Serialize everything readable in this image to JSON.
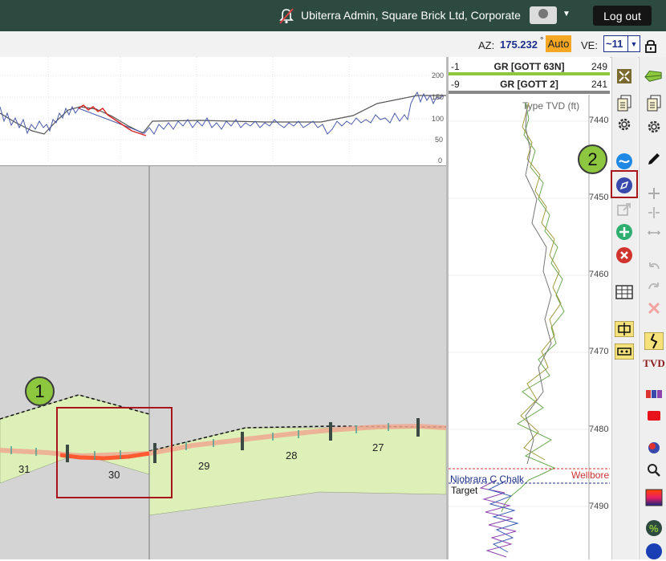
{
  "header": {
    "user_label": "Ubiterra Admin, Square Brick Ltd, Corporate",
    "logout_label": "Log out"
  },
  "toolbar": {
    "az_label": "AZ:",
    "az_value": "175.232",
    "az_unit": "°",
    "auto_label": "Auto",
    "ve_label": "VE:",
    "ve_value": "~11"
  },
  "gr_chart": {
    "y_ticks": [
      "200",
      "150",
      "100",
      "50",
      "0"
    ]
  },
  "cross_section": {
    "segment_labels": [
      "31",
      "30",
      "29",
      "28",
      "27"
    ]
  },
  "type_log": {
    "tracks": [
      {
        "min": "-1",
        "name": "GR [GOTT 63N]",
        "max": "249",
        "color": "#8dc63f"
      },
      {
        "min": "-9",
        "name": "GR [GOTT 2]",
        "max": "241",
        "color": "#888888"
      }
    ],
    "axis_label": "Type TVD (ft)",
    "depths": [
      "7440",
      "7450",
      "7460",
      "7470",
      "7480",
      "7490"
    ],
    "formation": "Niobrara C Chalk",
    "target": "Target",
    "wellbore": "Wellbore"
  },
  "annotations": {
    "badge1": "1",
    "badge2": "2"
  },
  "icons": {
    "far_tvd_label": "TVD"
  },
  "colors": {
    "header_bg": "#2c4a3f",
    "accent_green": "#8dc63f",
    "highlight_red": "#a8161b",
    "auto_orange": "#f5a623",
    "az_blue": "#1c2f8a"
  }
}
